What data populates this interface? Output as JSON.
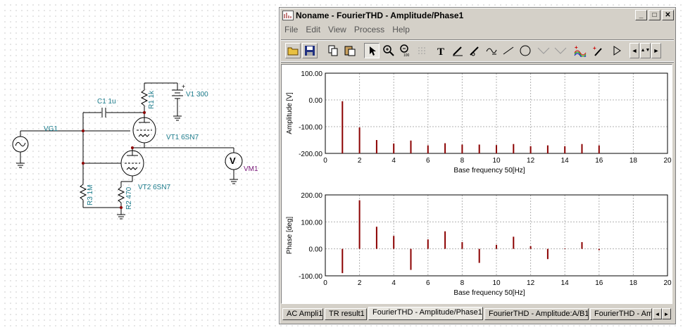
{
  "schematic": {
    "labels": {
      "c1": "C1 1u",
      "r1": "R1 1k",
      "v1": "V1 300",
      "vg1": "VG1",
      "vt1": "VT1 6SN7",
      "vt2": "VT2 6SN7",
      "vm1": "VM1",
      "r3": "R3 1M",
      "r2": "R2 470"
    }
  },
  "window": {
    "title": "Noname - FourierTHD - Amplitude/Phase1",
    "controls": {
      "minimize": "_",
      "maximize": "□",
      "close": "✕"
    },
    "menu": [
      "File",
      "Edit",
      "View",
      "Process",
      "Help"
    ],
    "toolbar": [
      {
        "icon": "open-folder-icon"
      },
      {
        "icon": "save-icon"
      },
      {
        "icon": "copy-icon"
      },
      {
        "icon": "paste-icon"
      },
      {
        "icon": "pointer-icon",
        "pressed": true
      },
      {
        "icon": "zoom-in-icon"
      },
      {
        "icon": "zoom-100-icon"
      },
      {
        "icon": "grid-icon"
      },
      {
        "icon": "text-icon"
      },
      {
        "icon": "pen-tool-icon"
      },
      {
        "icon": "pen-tool-2-icon"
      },
      {
        "icon": "equation-icon"
      },
      {
        "icon": "line-icon"
      },
      {
        "icon": "circle-icon"
      },
      {
        "icon": "trace-line-icon"
      },
      {
        "icon": "trace-line-2-icon"
      },
      {
        "icon": "add-curve-icon"
      },
      {
        "icon": "add-marker-icon"
      },
      {
        "icon": "play-icon"
      }
    ],
    "toolbar_nav": {
      "left": "◄",
      "updown": "▲▼",
      "right": "►"
    }
  },
  "chart_data": [
    {
      "type": "bar",
      "ylabel": "Amplitude [V]",
      "xlabel": "Base frequency 50[Hz]",
      "xlim": [
        0,
        20
      ],
      "ylim": [
        -200,
        100
      ],
      "x_ticks": [
        "0",
        "2",
        "4",
        "6",
        "8",
        "10",
        "12",
        "14",
        "16",
        "18",
        "20"
      ],
      "y_ticks": [
        "100.00",
        "0.00",
        "-100.00",
        "-200.00"
      ],
      "grid": true,
      "bar_color": "#8b0000",
      "x": [
        1,
        2,
        3,
        4,
        5,
        6,
        7,
        8,
        9,
        10,
        11,
        12,
        13,
        14,
        15,
        16
      ],
      "values": [
        -5,
        -103,
        -150,
        -163,
        -152,
        -170,
        -162,
        -167,
        -167,
        -169,
        -165,
        -173,
        -170,
        -173,
        -165,
        -170
      ]
    },
    {
      "type": "bar",
      "ylabel": "Phase [deg]",
      "xlabel": "Base frequency 50[Hz]",
      "xlim": [
        0,
        20
      ],
      "ylim": [
        -100,
        200
      ],
      "x_ticks": [
        "0",
        "2",
        "4",
        "6",
        "8",
        "10",
        "12",
        "14",
        "16",
        "18",
        "20"
      ],
      "y_ticks": [
        "200.00",
        "100.00",
        "0.00",
        "-100.00"
      ],
      "grid": true,
      "bar_color": "#8b0000",
      "x": [
        1,
        2,
        3,
        4,
        5,
        6,
        7,
        8,
        9,
        10,
        11,
        12,
        13,
        14,
        15,
        16
      ],
      "values": [
        -90,
        180,
        82,
        48,
        -78,
        35,
        65,
        25,
        -52,
        15,
        45,
        10,
        -38,
        2,
        25,
        -5
      ]
    }
  ],
  "tabs": [
    {
      "label": "AC Ampli1",
      "active": false
    },
    {
      "label": "TR result1",
      "active": false
    },
    {
      "label": "FourierTHD - Amplitude/Phase1",
      "active": true
    },
    {
      "label": "FourierTHD - Amplitude:A/B1",
      "active": false
    },
    {
      "label": "FourierTHD - Am",
      "active": false
    }
  ],
  "tab_scroll": {
    "left": "◄",
    "right": "►"
  }
}
